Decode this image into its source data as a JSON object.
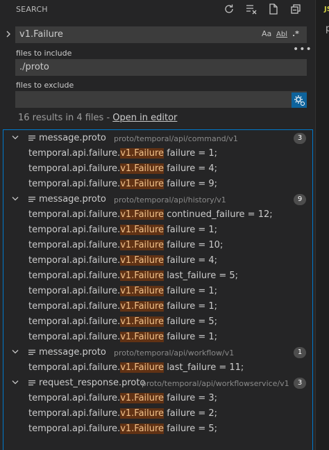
{
  "colors": {
    "accent": "#007acc",
    "match_highlight": "#613214",
    "badge": "#4d4d4d"
  },
  "header": {
    "title": "SEARCH"
  },
  "editor_fragment": {
    "tab": "JS",
    "text": "p"
  },
  "search": {
    "query": "v1.Failure",
    "options": {
      "match_case": "Aa",
      "whole_word": "Abl",
      "regex": ".*"
    },
    "include_label": "files to include",
    "include_value": "./proto",
    "exclude_label": "files to exclude",
    "exclude_value": ""
  },
  "summary": {
    "text": "16 results in 4 files - ",
    "link": "Open in editor"
  },
  "results": [
    {
      "file": "message.proto",
      "path": "proto/temporal/api/command/v1",
      "count": "3",
      "matches": [
        {
          "pre": "temporal.api.failure.",
          "hit": "v1.Failure",
          "post": " failure = 1;"
        },
        {
          "pre": "temporal.api.failure.",
          "hit": "v1.Failure",
          "post": " failure = 4;"
        },
        {
          "pre": "temporal.api.failure.",
          "hit": "v1.Failure",
          "post": " failure = 9;"
        }
      ]
    },
    {
      "file": "message.proto",
      "path": "proto/temporal/api/history/v1",
      "count": "9",
      "matches": [
        {
          "pre": "temporal.api.failure.",
          "hit": "v1.Failure",
          "post": " continued_failure = 12;"
        },
        {
          "pre": "temporal.api.failure.",
          "hit": "v1.Failure",
          "post": " failure = 1;"
        },
        {
          "pre": "temporal.api.failure.",
          "hit": "v1.Failure",
          "post": " failure = 10;"
        },
        {
          "pre": "temporal.api.failure.",
          "hit": "v1.Failure",
          "post": " failure = 4;"
        },
        {
          "pre": "temporal.api.failure.",
          "hit": "v1.Failure",
          "post": " last_failure = 5;"
        },
        {
          "pre": "temporal.api.failure.",
          "hit": "v1.Failure",
          "post": " failure = 1;"
        },
        {
          "pre": "temporal.api.failure.",
          "hit": "v1.Failure",
          "post": " failure = 1;"
        },
        {
          "pre": "temporal.api.failure.",
          "hit": "v1.Failure",
          "post": " failure = 5;"
        },
        {
          "pre": "temporal.api.failure.",
          "hit": "v1.Failure",
          "post": " failure = 1;"
        }
      ]
    },
    {
      "file": "message.proto",
      "path": "proto/temporal/api/workflow/v1",
      "count": "1",
      "matches": [
        {
          "pre": "temporal.api.failure.",
          "hit": "v1.Failure",
          "post": " last_failure = 11;"
        }
      ]
    },
    {
      "file": "request_response.proto",
      "path": "proto/temporal/api/workflowservice/v1",
      "count": "3",
      "matches": [
        {
          "pre": "temporal.api.failure.",
          "hit": "v1.Failure",
          "post": " failure = 3;"
        },
        {
          "pre": "temporal.api.failure.",
          "hit": "v1.Failure",
          "post": " failure = 2;"
        },
        {
          "pre": "temporal.api.failure.",
          "hit": "v1.Failure",
          "post": " failure = 5;"
        }
      ]
    }
  ]
}
